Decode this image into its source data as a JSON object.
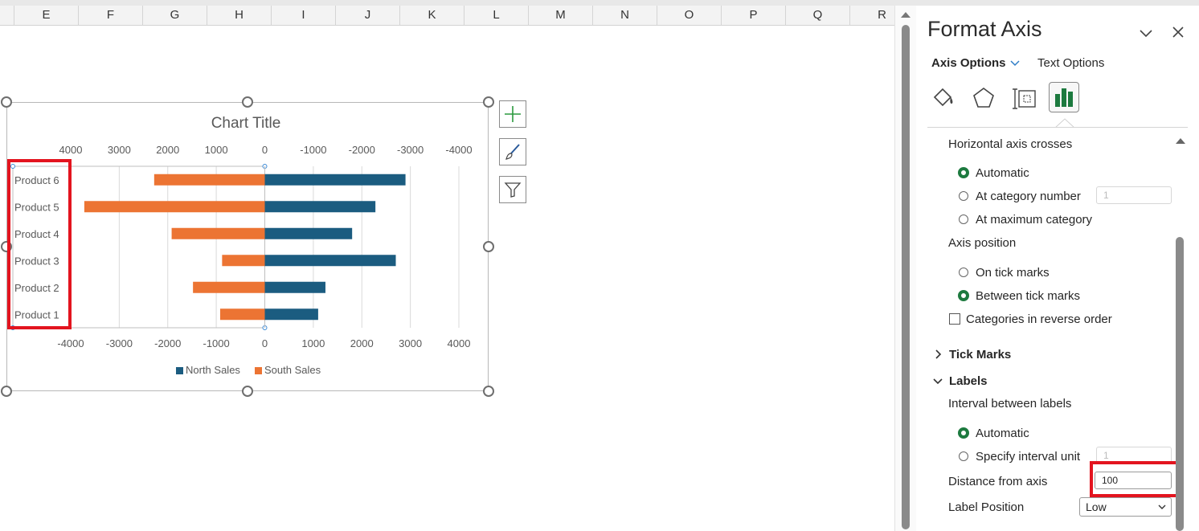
{
  "columns": [
    "E",
    "F",
    "G",
    "H",
    "I",
    "J",
    "K",
    "L",
    "M",
    "N",
    "O",
    "P",
    "Q",
    "R"
  ],
  "chart_data": {
    "type": "bar",
    "orientation": "horizontal",
    "title": "Chart Title",
    "categories": [
      "Product 1",
      "Product 2",
      "Product 3",
      "Product 4",
      "Product 5",
      "Product 6"
    ],
    "series": [
      {
        "name": "North Sales",
        "color": "#1b5c80",
        "values": [
          1100,
          1250,
          2700,
          1800,
          2280,
          2900
        ]
      },
      {
        "name": "South Sales",
        "color": "#ec7433",
        "values": [
          -920,
          -1480,
          -880,
          -1920,
          -3720,
          -2280
        ]
      }
    ],
    "xlim": [
      -4000,
      4000
    ],
    "bottom_ticks": [
      "-4000",
      "-3000",
      "-2000",
      "-1000",
      "0",
      "1000",
      "2000",
      "3000",
      "4000"
    ],
    "top_ticks": [
      "4000",
      "3000",
      "2000",
      "1000",
      "0",
      "-1000",
      "-2000",
      "-3000",
      "-4000"
    ],
    "grid": true,
    "legend": "bottom"
  },
  "panel": {
    "title": "Format Axis",
    "tab_axis": "Axis Options",
    "tab_text": "Text Options",
    "horizontal_crosses": "Horizontal axis crosses",
    "automatic": "Automatic",
    "at_category_number": "At category number",
    "category_number_value": "1",
    "at_max_category": "At maximum category",
    "axis_position": "Axis position",
    "on_tick_marks": "On tick marks",
    "between_tick_marks": "Between tick marks",
    "categories_reverse": "Categories in reverse order",
    "tick_marks": "Tick Marks",
    "labels": "Labels",
    "interval_labels": "Interval between labels",
    "labels_automatic": "Automatic",
    "specify_interval": "Specify interval unit",
    "interval_value": "1",
    "distance_from_axis": "Distance from axis",
    "distance_value": "100",
    "label_position": "Label Position",
    "label_position_value": "Low"
  },
  "colors": {
    "accent_green": "#1d7a3f",
    "highlight_red": "#e3141f"
  }
}
